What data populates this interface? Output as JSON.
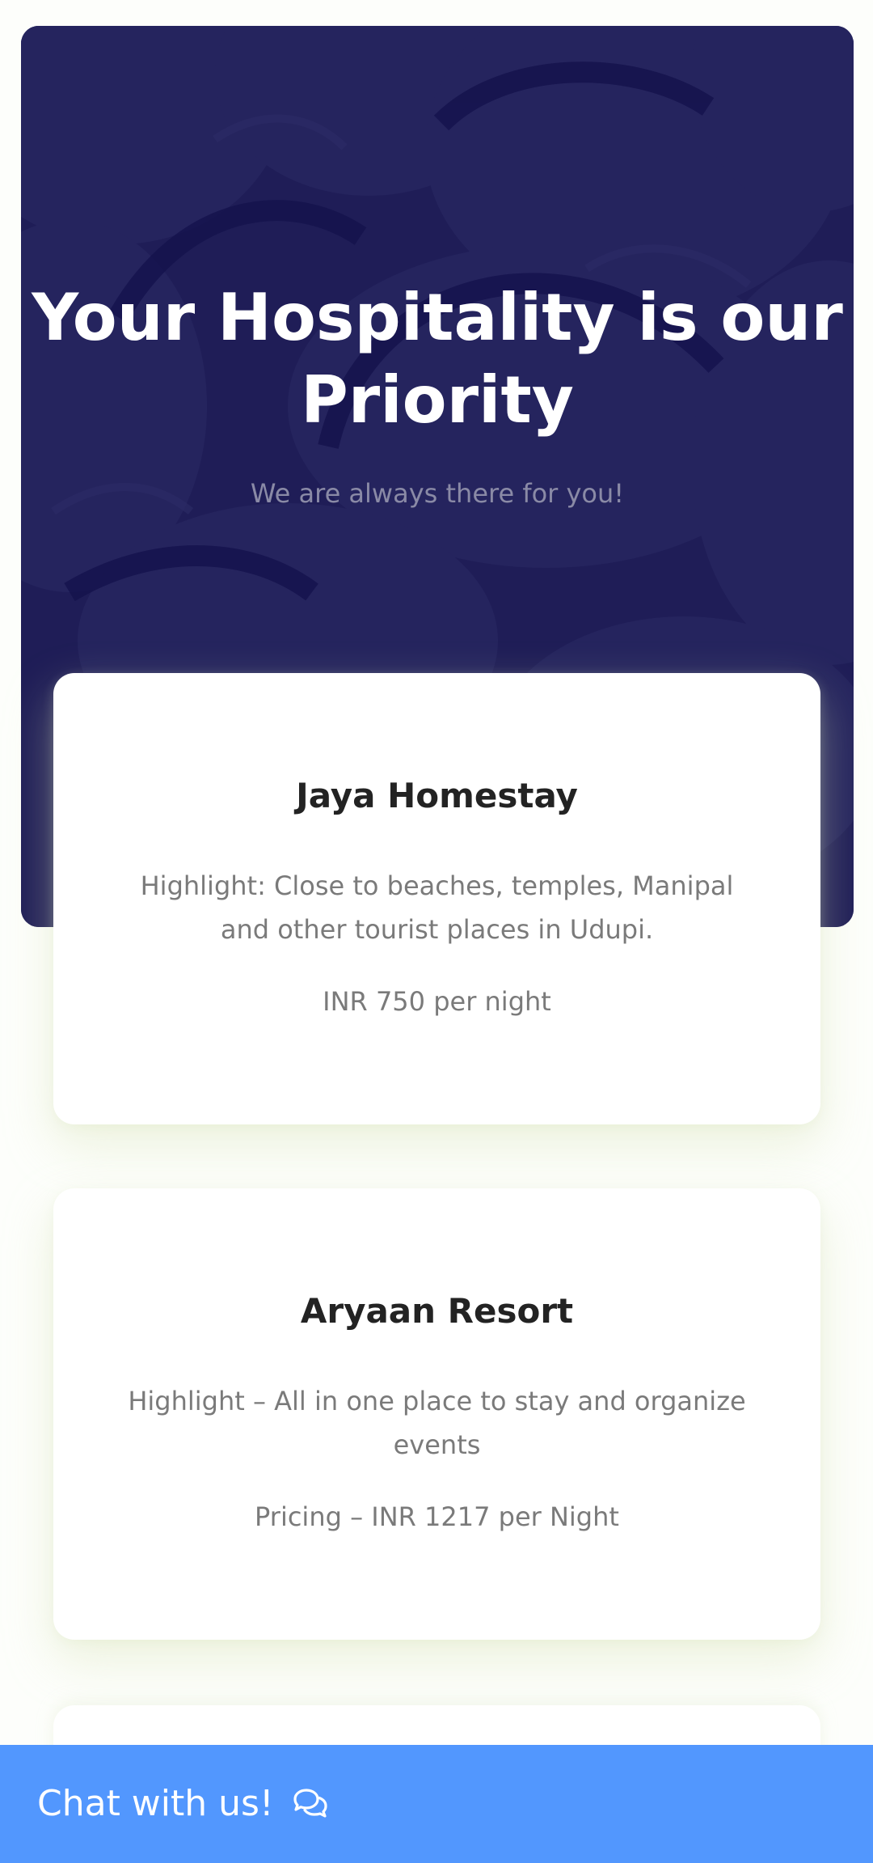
{
  "hero": {
    "title": "Your Hospitality is our Priority",
    "subtitle": "We are always there for you!"
  },
  "listings": [
    {
      "name": "Jaya Homestay",
      "highlight": "Highlight: Close to beaches, temples, Manipal and other tourist places in Udupi.",
      "price": "INR 750 per night"
    },
    {
      "name": "Aryaan Resort",
      "highlight": "Highlight – All in one place to stay and organize events",
      "price": "Pricing – INR 1217 per Night"
    }
  ],
  "chat": {
    "label": "Chat with us!",
    "icon": "chat-bubbles-icon"
  },
  "colors": {
    "hero_overlay": "#1b1a52",
    "chat_bar": "#5297fe",
    "card_background": "#ffffff",
    "title_text": "#232323",
    "body_text": "#7a7a7a"
  }
}
